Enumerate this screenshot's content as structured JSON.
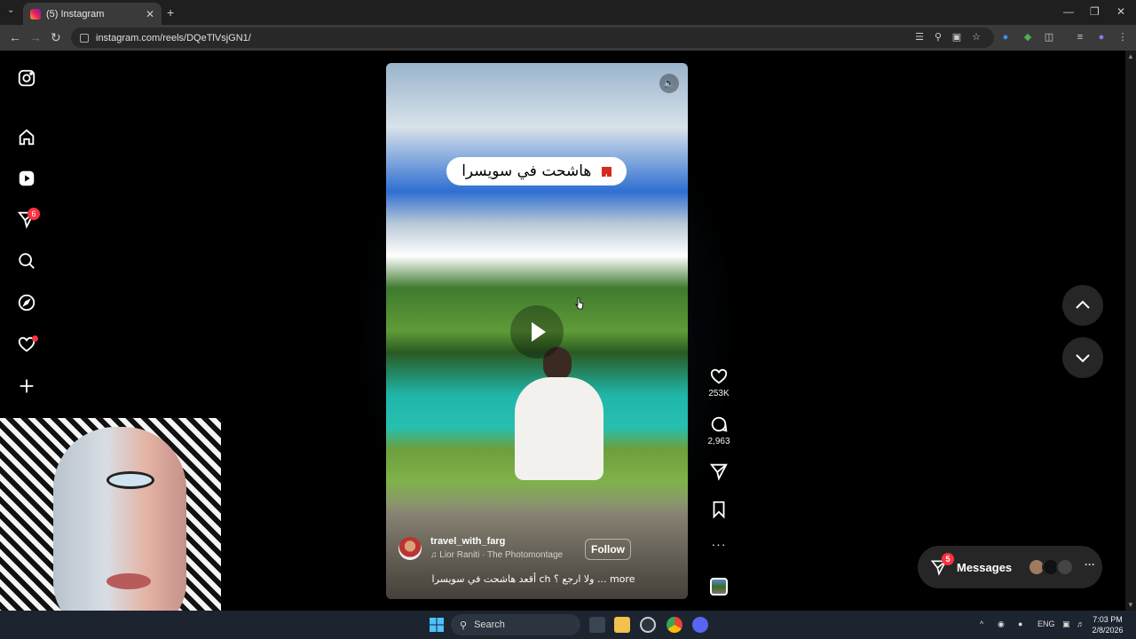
{
  "browser": {
    "tab_title": "(5) Instagram",
    "tab_close": "✕",
    "new_tab": "+",
    "tab_dropdown": "⌄",
    "url": "instagram.com/reels/DQeTlVsjGN1/",
    "window_controls": {
      "minimize": "—",
      "restore": "❐",
      "close": "✕"
    }
  },
  "sidebar": {
    "notifications_badge": "6"
  },
  "reel": {
    "overlay_text": "هاشحت في سويسرا",
    "username": "travel_with_farg",
    "audio": "♫ Lior Raniti · The Photomontage",
    "follow_label": "Follow",
    "caption": "أقعد هاشحت في سويسرا ch ولا ارجع ؟ ... more"
  },
  "actions": {
    "likes": "253K",
    "comments": "2,963",
    "more": "···"
  },
  "messages": {
    "label": "Messages",
    "badge": "5",
    "more": "···"
  },
  "taskbar": {
    "search_label": "Search",
    "language": "ENG",
    "time": "7:03 PM",
    "date": "2/8/2026"
  },
  "colors": {
    "badge": "#ff3040",
    "background": "#000000",
    "button_bg": "#262626"
  }
}
